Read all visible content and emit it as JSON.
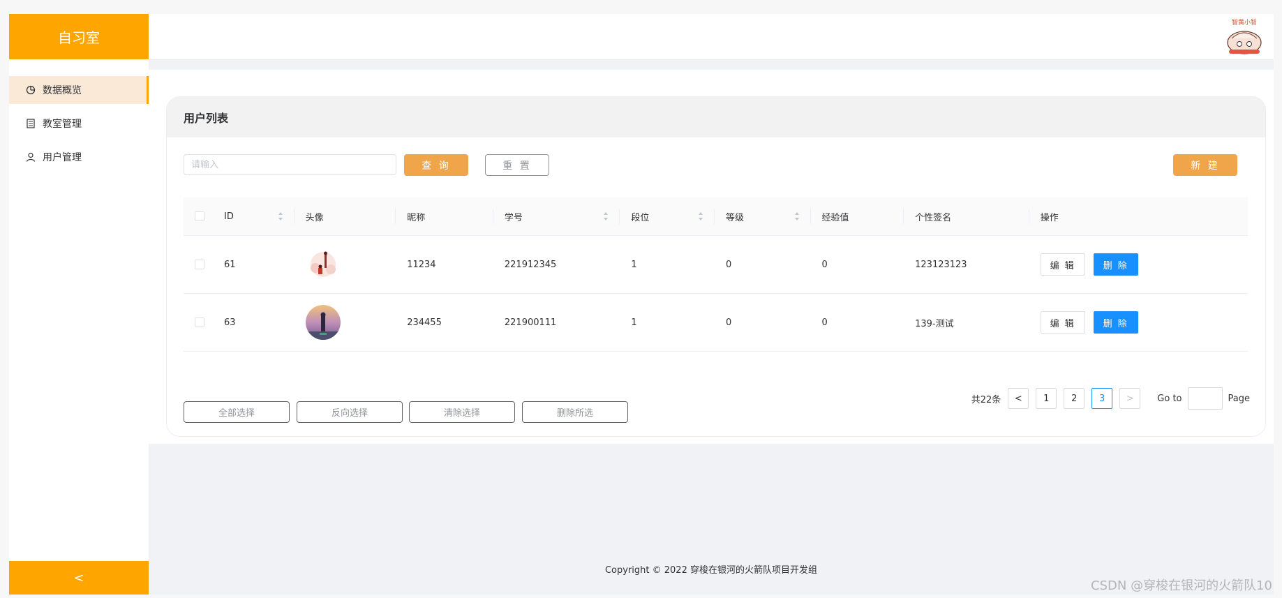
{
  "app": {
    "brand": "自习室"
  },
  "sidebar": {
    "items": [
      {
        "label": "数据概览",
        "icon": "pie-chart-icon",
        "active": true
      },
      {
        "label": "教室管理",
        "icon": "document-icon",
        "active": false
      },
      {
        "label": "用户管理",
        "icon": "user-icon",
        "active": false
      }
    ],
    "collapse_label": "<"
  },
  "header": {
    "mascot_text": "智黄小智"
  },
  "card": {
    "title": "用户列表"
  },
  "search": {
    "placeholder": "请输入",
    "value": ""
  },
  "toolbar": {
    "query_label": "查 询",
    "reset_label": "重 置",
    "new_label": "新 建"
  },
  "table": {
    "columns": [
      "ID",
      "头像",
      "昵称",
      "学号",
      "段位",
      "等级",
      "经验值",
      "个性签名",
      "操作"
    ],
    "rows": [
      {
        "id": "61",
        "avatar": "avatar-illustration",
        "nickname": "11234",
        "student_no": "221912345",
        "rank": "1",
        "level": "0",
        "exp": "0",
        "signature": "123123123"
      },
      {
        "id": "63",
        "avatar": "avatar-photo",
        "nickname": "234455",
        "student_no": "221900111",
        "rank": "1",
        "level": "0",
        "exp": "0",
        "signature": "139-测试"
      }
    ],
    "edit_label": "编 辑",
    "delete_label": "删 除"
  },
  "pagination": {
    "total_text": "共22条",
    "prev": "<",
    "next": ">",
    "pages": [
      "1",
      "2",
      "3"
    ],
    "current": "3",
    "goto_label": "Go to",
    "page_label": "Page"
  },
  "bulk": {
    "select_all": "全部选择",
    "invert": "反向选择",
    "clear": "清除选择",
    "delete_selected": "删除所选"
  },
  "footer": {
    "copyright": "Copyright © 2022 穿梭在银河的火箭队项目开发组"
  },
  "watermark": "CSDN @穿梭在银河的火箭队10",
  "colors": {
    "brand": "#ffa500",
    "accent": "#f0a54a",
    "danger_button": "#1890ff",
    "active_nav_bg": "#fbe9d8"
  }
}
